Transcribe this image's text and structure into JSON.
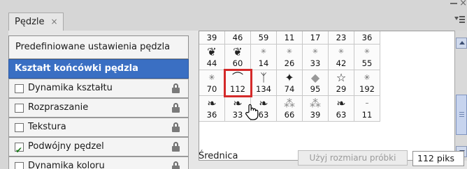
{
  "panel": {
    "tab_label": "Pędzle",
    "close_glyph": "×",
    "window_close_glyph": "×"
  },
  "left": {
    "preset_button": "Predefiniowane ustawienia pędzla",
    "items": [
      {
        "label": "Kształt końcówki pędzla",
        "selected": true
      },
      {
        "label": "Dynamika kształtu",
        "checked": false
      },
      {
        "label": "Rozpraszanie",
        "checked": false
      },
      {
        "label": "Tekstura",
        "checked": false
      },
      {
        "label": "Podwójny pędzel",
        "checked": true
      },
      {
        "label": "Dynamika koloru",
        "checked": false
      }
    ]
  },
  "brushes": {
    "row1": [
      "39",
      "46",
      "59",
      "11",
      "17",
      "23",
      "36"
    ],
    "row2": [
      "44",
      "60",
      "14",
      "26",
      "33",
      "42",
      "55"
    ],
    "row3": [
      "70",
      "112",
      "134",
      "74",
      "95",
      "29",
      "192"
    ],
    "row4": [
      "36",
      "33",
      "63",
      "66",
      "39",
      "63",
      "11"
    ],
    "selected": "112"
  },
  "diameter": {
    "label": "Średnica",
    "use_sample_button": "Użyj rozmiaru próbki",
    "value": "112 piks"
  },
  "colors": {
    "selected_row": "#3a6fc3",
    "highlight_border": "#d42a2a"
  }
}
